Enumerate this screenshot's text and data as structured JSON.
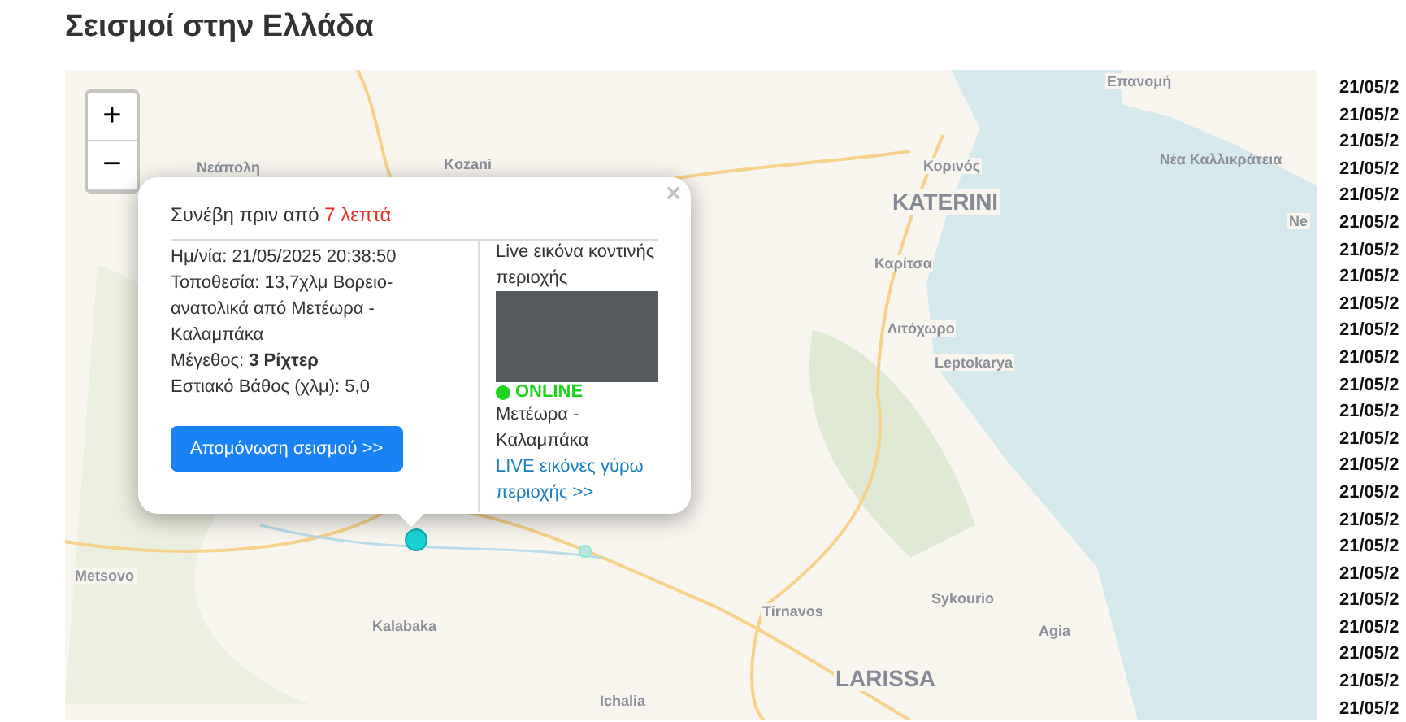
{
  "title": "Σεισμοί στην Ελλάδα",
  "map": {
    "zoom_in": "+",
    "zoom_out": "−",
    "labels": [
      {
        "text": "Επανομή",
        "kind": "town"
      },
      {
        "text": "Νεάπολη",
        "kind": "town"
      },
      {
        "text": "Kozani",
        "kind": "town"
      },
      {
        "text": "Κορινός",
        "kind": "town"
      },
      {
        "text": "KATERINI",
        "kind": "city"
      },
      {
        "text": "Νέα Καλλικράτεια",
        "kind": "town"
      },
      {
        "text": "Ne",
        "kind": "town"
      },
      {
        "text": "Καρίτσα",
        "kind": "town"
      },
      {
        "text": "Λιτόχωρο",
        "kind": "town"
      },
      {
        "text": "Leptokarya",
        "kind": "town"
      },
      {
        "text": "Metsovo",
        "kind": "town"
      },
      {
        "text": "Sykourio",
        "kind": "town"
      },
      {
        "text": "Tirnavos",
        "kind": "town"
      },
      {
        "text": "Agia",
        "kind": "town"
      },
      {
        "text": "Kalabaka",
        "kind": "town"
      },
      {
        "text": "LARISSA",
        "kind": "city"
      },
      {
        "text": "Ichalia",
        "kind": "town"
      }
    ],
    "popup": {
      "close": "×",
      "ago_prefix": "Συνέβη πριν από",
      "ago_value": "7 λεπτά",
      "details": [
        "Ημ/νία: 21/05/2025 20:38:50",
        "Τοποθεσία: 13,7χλμ Βορειο-ανατολικά από Μετέωρα - Καλαμπάκα",
        "Μέγεθος: **3 Ρίχτερ**",
        "Εστιακό Βάθος (χλμ): 5,0"
      ],
      "button": "Απομόνωση σεισμού >>",
      "camera": {
        "heading": "Live εικόνα κοντινής περιοχής",
        "online": true,
        "status": "ONLINE",
        "name": "Μετέωρα - Καλαμπάκα",
        "link": "LIVE εικόνες γύρω περιοχής >>"
      }
    }
  },
  "list": [
    "21/05/2",
    "21/05/2",
    "21/05/2",
    "21/05/2",
    "21/05/2",
    "21/05/2",
    "21/05/2",
    "21/05/2",
    "21/05/2",
    "21/05/2",
    "21/05/2",
    "21/05/2",
    "21/05/2",
    "21/05/2",
    "21/05/2",
    "21/05/2",
    "21/05/2",
    "21/05/2",
    "21/05/2",
    "21/05/2",
    "21/05/2",
    "21/05/2",
    "21/05/2",
    "21/05/2"
  ]
}
